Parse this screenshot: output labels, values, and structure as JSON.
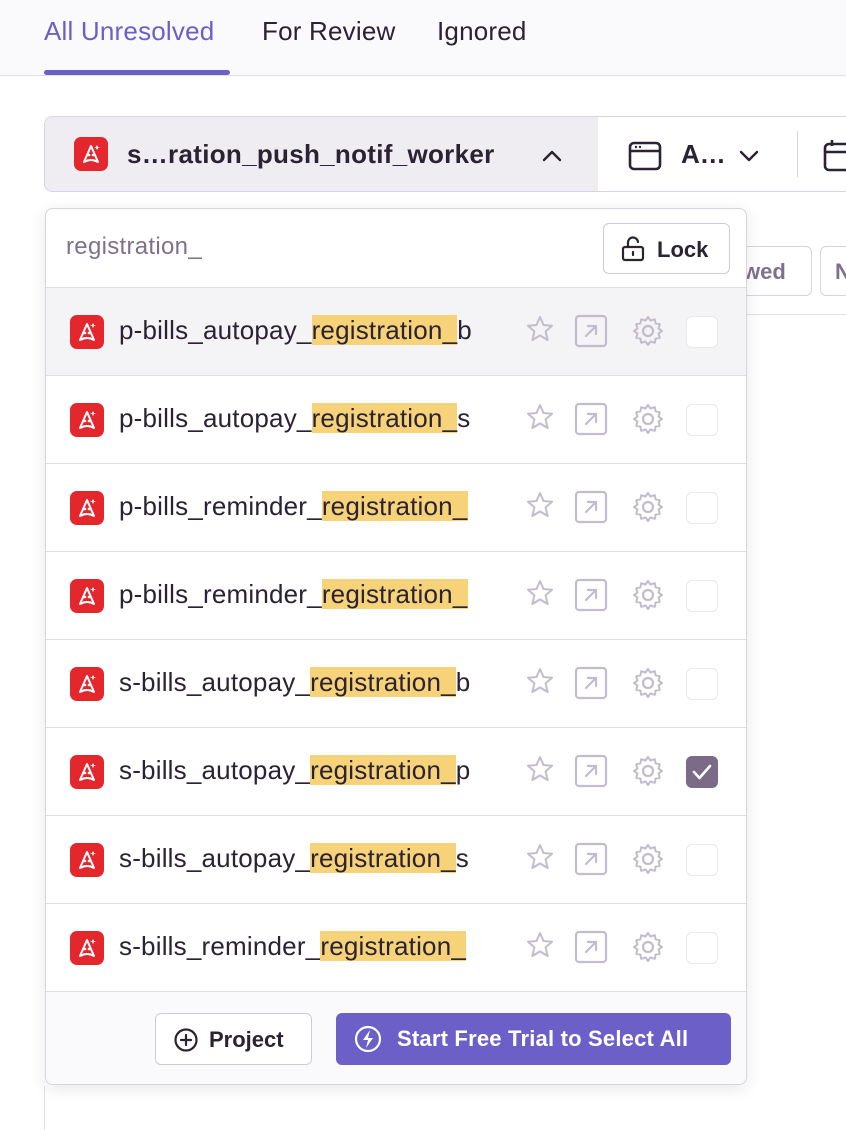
{
  "tabs": [
    {
      "label": "All Unresolved",
      "active": true
    },
    {
      "label": "For Review",
      "active": false
    },
    {
      "label": "Ignored",
      "active": false
    }
  ],
  "filters": {
    "project_label": "s…ration_push_notif_worker",
    "environment_label": "A…"
  },
  "background_buttons": [
    "wed",
    "N"
  ],
  "dropdown": {
    "search_value": "registration_",
    "lock_label": "Lock",
    "items": [
      {
        "prefix": "p-bills_autopay_",
        "match": "registration_",
        "suffix": "b",
        "checked": false,
        "hover": true
      },
      {
        "prefix": "p-bills_autopay_",
        "match": "registration_",
        "suffix": "s",
        "checked": false,
        "hover": false
      },
      {
        "prefix": "p-bills_reminder_",
        "match": "registration_",
        "suffix": "",
        "checked": false,
        "hover": false
      },
      {
        "prefix": "p-bills_reminder_",
        "match": "registration_",
        "suffix": "",
        "checked": false,
        "hover": false
      },
      {
        "prefix": "s-bills_autopay_",
        "match": "registration_",
        "suffix": "b",
        "checked": false,
        "hover": false
      },
      {
        "prefix": "s-bills_autopay_",
        "match": "registration_",
        "suffix": "p",
        "checked": true,
        "hover": false
      },
      {
        "prefix": "s-bills_autopay_",
        "match": "registration_",
        "suffix": "s",
        "checked": false,
        "hover": false
      },
      {
        "prefix": "s-bills_reminder_",
        "match": "registration_",
        "suffix": "",
        "checked": false,
        "hover": false
      }
    ],
    "footer": {
      "project_button": "Project",
      "trial_button": "Start Free Trial to Select All"
    }
  },
  "colors": {
    "accent": "#6c5fc7",
    "highlight": "#f6d379",
    "app_icon": "#e3272d",
    "checked": "#7b6b86"
  },
  "icons": {
    "app": "android-icon",
    "star": "star-icon",
    "external": "external-link-icon",
    "settings": "gear-icon",
    "lock": "unlock-icon",
    "add": "plus-circle-icon",
    "trial": "lightning-icon",
    "calendar": "calendar-icon"
  }
}
